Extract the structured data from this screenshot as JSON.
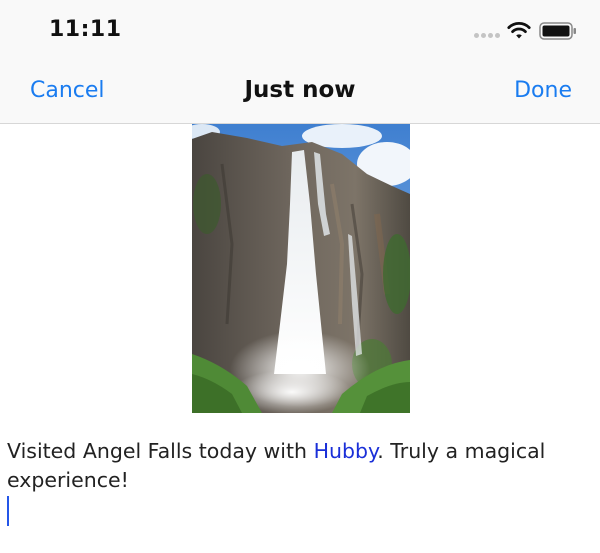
{
  "status_bar": {
    "time": "11:11",
    "icons": [
      "signal-dots-icon",
      "wifi-icon",
      "battery-icon"
    ]
  },
  "nav": {
    "cancel_label": "Cancel",
    "title": "Just now",
    "done_label": "Done"
  },
  "post": {
    "photo_subject": "waterfall",
    "caption_before": "Visited Angel Falls today with ",
    "mention": "Hubby",
    "caption_after": ". Truly a magical experience!"
  },
  "colors": {
    "accent": "#1a7cf0",
    "mention": "#1a2fd8",
    "cursor": "#2456e8"
  }
}
